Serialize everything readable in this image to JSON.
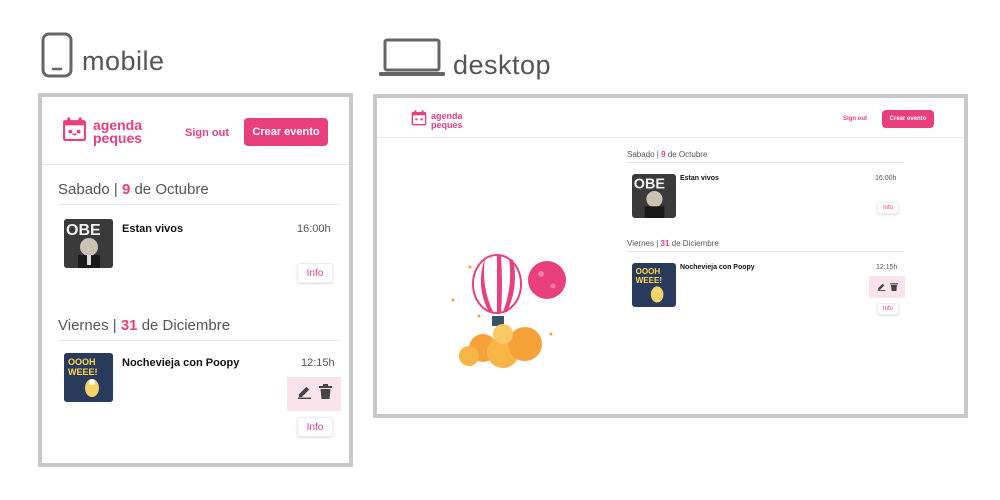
{
  "labels": {
    "mobile": "mobile",
    "desktop": "desktop"
  },
  "brand": {
    "line1": "agenda",
    "line2": "peques"
  },
  "header": {
    "signout": "Sign out",
    "create": "Crear evento"
  },
  "days": [
    {
      "weekday": "Sabado |",
      "daynum": "9",
      "month": "de Octubre",
      "event": {
        "title": "Estan vivos",
        "time": "16:00h",
        "info": "Info",
        "thumb_text": "OBE"
      }
    },
    {
      "weekday": "Viernes |",
      "daynum": "31",
      "month": "de Diciembre",
      "event": {
        "title": "Nochevieja con Poopy",
        "time": "12:15h",
        "info": "Info",
        "thumb_text": "OOOH WEEE!"
      }
    }
  ],
  "colors": {
    "accent": "#e9407d",
    "frame": "#c8c8c8",
    "action_bg": "#fbe3ec",
    "thumb1_bg": "#2b2b2b",
    "thumb2_bg": "#2a3a5c"
  },
  "icons": [
    "phone-icon",
    "laptop-icon",
    "calendar-logo-icon",
    "pencil-icon",
    "trash-icon",
    "balloon-illustration"
  ]
}
